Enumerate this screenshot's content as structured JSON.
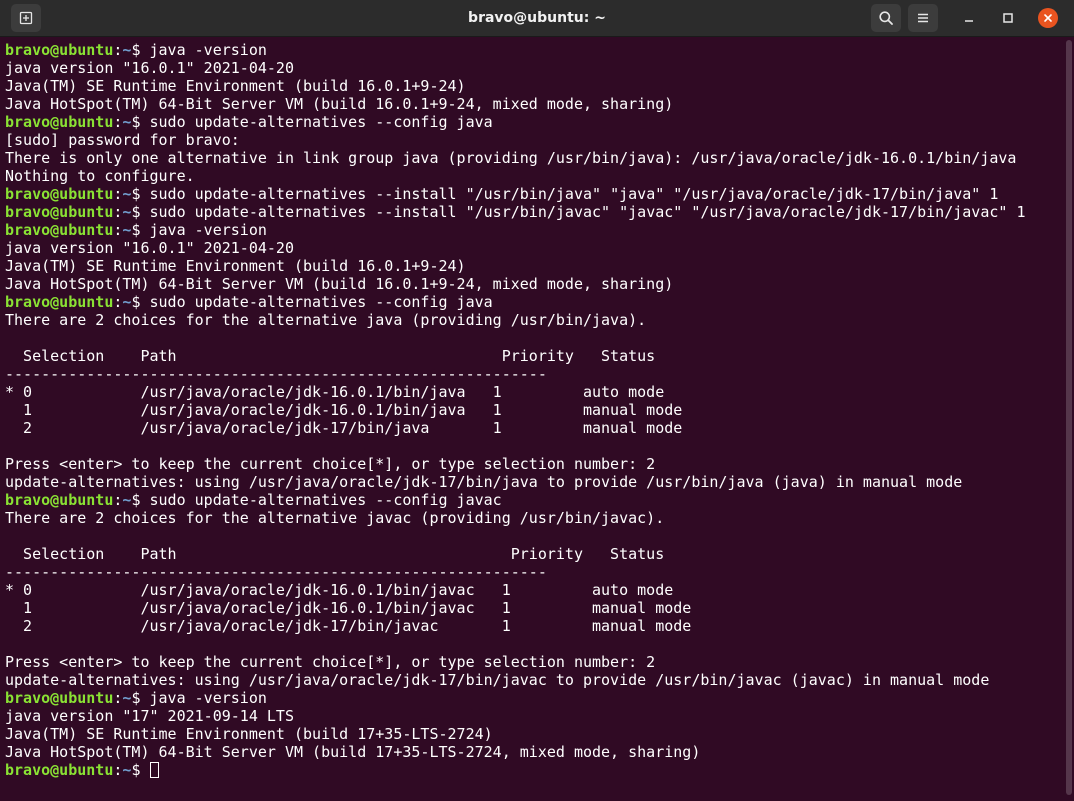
{
  "window": {
    "title": "bravo@ubuntu: ~"
  },
  "prompt": {
    "user_host": "bravo@ubuntu",
    "sep": ":",
    "path": "~",
    "dollar": "$ "
  },
  "lines": [
    {
      "type": "cmd",
      "text": "java -version"
    },
    {
      "type": "out",
      "text": "java version \"16.0.1\" 2021-04-20"
    },
    {
      "type": "out",
      "text": "Java(TM) SE Runtime Environment (build 16.0.1+9-24)"
    },
    {
      "type": "out",
      "text": "Java HotSpot(TM) 64-Bit Server VM (build 16.0.1+9-24, mixed mode, sharing)"
    },
    {
      "type": "cmd",
      "text": "sudo update-alternatives --config java"
    },
    {
      "type": "out",
      "text": "[sudo] password for bravo:"
    },
    {
      "type": "out",
      "text": "There is only one alternative in link group java (providing /usr/bin/java): /usr/java/oracle/jdk-16.0.1/bin/java"
    },
    {
      "type": "out",
      "text": "Nothing to configure."
    },
    {
      "type": "cmd",
      "text": "sudo update-alternatives --install \"/usr/bin/java\" \"java\" \"/usr/java/oracle/jdk-17/bin/java\" 1"
    },
    {
      "type": "cmd",
      "text": "sudo update-alternatives --install \"/usr/bin/javac\" \"javac\" \"/usr/java/oracle/jdk-17/bin/javac\" 1"
    },
    {
      "type": "cmd",
      "text": "java -version"
    },
    {
      "type": "out",
      "text": "java version \"16.0.1\" 2021-04-20"
    },
    {
      "type": "out",
      "text": "Java(TM) SE Runtime Environment (build 16.0.1+9-24)"
    },
    {
      "type": "out",
      "text": "Java HotSpot(TM) 64-Bit Server VM (build 16.0.1+9-24, mixed mode, sharing)"
    },
    {
      "type": "cmd",
      "text": "sudo update-alternatives --config java"
    },
    {
      "type": "out",
      "text": "There are 2 choices for the alternative java (providing /usr/bin/java)."
    },
    {
      "type": "out",
      "text": ""
    },
    {
      "type": "out",
      "text": "  Selection    Path                                    Priority   Status"
    },
    {
      "type": "out",
      "text": "------------------------------------------------------------"
    },
    {
      "type": "out",
      "text": "* 0            /usr/java/oracle/jdk-16.0.1/bin/java   1         auto mode"
    },
    {
      "type": "out",
      "text": "  1            /usr/java/oracle/jdk-16.0.1/bin/java   1         manual mode"
    },
    {
      "type": "out",
      "text": "  2            /usr/java/oracle/jdk-17/bin/java       1         manual mode"
    },
    {
      "type": "out",
      "text": ""
    },
    {
      "type": "out",
      "text": "Press <enter> to keep the current choice[*], or type selection number: 2"
    },
    {
      "type": "out",
      "text": "update-alternatives: using /usr/java/oracle/jdk-17/bin/java to provide /usr/bin/java (java) in manual mode"
    },
    {
      "type": "cmd",
      "text": "sudo update-alternatives --config javac"
    },
    {
      "type": "out",
      "text": "There are 2 choices for the alternative javac (providing /usr/bin/javac)."
    },
    {
      "type": "out",
      "text": ""
    },
    {
      "type": "out",
      "text": "  Selection    Path                                     Priority   Status"
    },
    {
      "type": "out",
      "text": "------------------------------------------------------------"
    },
    {
      "type": "out",
      "text": "* 0            /usr/java/oracle/jdk-16.0.1/bin/javac   1         auto mode"
    },
    {
      "type": "out",
      "text": "  1            /usr/java/oracle/jdk-16.0.1/bin/javac   1         manual mode"
    },
    {
      "type": "out",
      "text": "  2            /usr/java/oracle/jdk-17/bin/javac       1         manual mode"
    },
    {
      "type": "out",
      "text": ""
    },
    {
      "type": "out",
      "text": "Press <enter> to keep the current choice[*], or type selection number: 2"
    },
    {
      "type": "out",
      "text": "update-alternatives: using /usr/java/oracle/jdk-17/bin/javac to provide /usr/bin/javac (javac) in manual mode"
    },
    {
      "type": "cmd",
      "text": "java -version"
    },
    {
      "type": "out",
      "text": "java version \"17\" 2021-09-14 LTS"
    },
    {
      "type": "out",
      "text": "Java(TM) SE Runtime Environment (build 17+35-LTS-2724)"
    },
    {
      "type": "out",
      "text": "Java HotSpot(TM) 64-Bit Server VM (build 17+35-LTS-2724, mixed mode, sharing)"
    },
    {
      "type": "cursor",
      "text": ""
    }
  ],
  "icons": {
    "new_tab": "new-tab-icon",
    "search": "search-icon",
    "menu": "hamburger-menu-icon",
    "minimize": "minimize-icon",
    "maximize": "maximize-icon",
    "close": "close-icon"
  },
  "colors": {
    "terminal_bg": "#300a24",
    "prompt_user": "#8ae234",
    "prompt_path": "#729fcf",
    "text": "#ffffff",
    "titlebar": "#2c2c2c",
    "close_button": "#e95420"
  }
}
